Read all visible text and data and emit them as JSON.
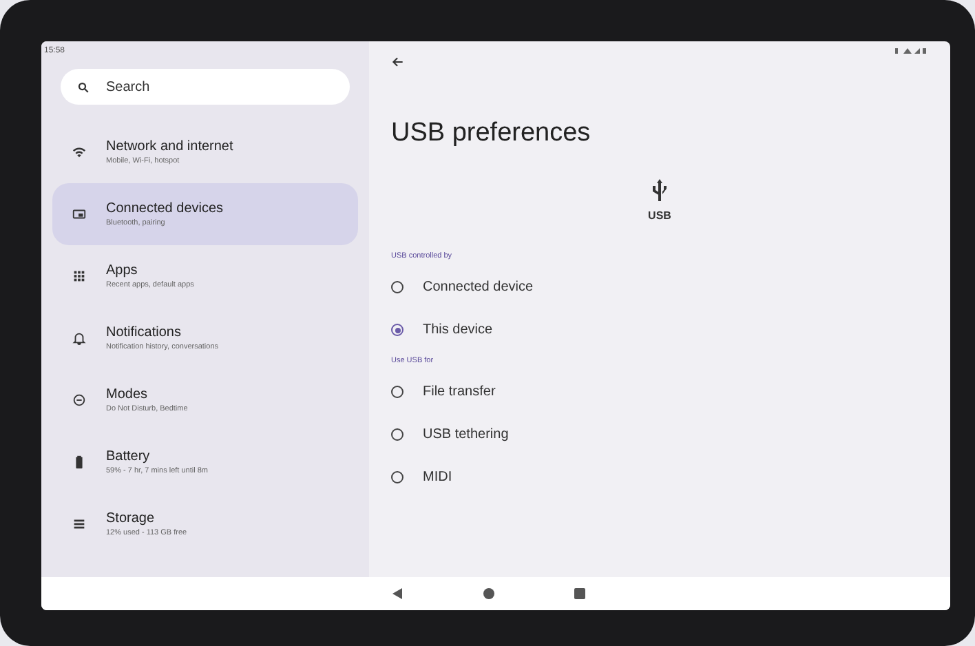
{
  "status_bar": {
    "time": "15:58"
  },
  "sidebar": {
    "search": {
      "placeholder": "Search"
    },
    "items": [
      {
        "kind": "wifi",
        "title": "Network and internet",
        "subtitle": "Mobile, Wi‑Fi, hotspot",
        "selected": false
      },
      {
        "kind": "devices",
        "title": "Connected devices",
        "subtitle": "Bluetooth, pairing",
        "selected": true
      },
      {
        "kind": "apps",
        "title": "Apps",
        "subtitle": "Recent apps, default apps",
        "selected": false
      },
      {
        "kind": "bell",
        "title": "Notifications",
        "subtitle": "Notification history, conversations",
        "selected": false
      },
      {
        "kind": "modes",
        "title": "Modes",
        "subtitle": "Do Not Disturb, Bedtime",
        "selected": false
      },
      {
        "kind": "battery",
        "title": "Battery",
        "subtitle": "59% - 7 hr, 7 mins left until 8m",
        "selected": false
      },
      {
        "kind": "storage",
        "title": "Storage",
        "subtitle": "12% used - 113 GB free",
        "selected": false
      }
    ]
  },
  "page": {
    "title": "USB preferences",
    "icon_label": "USB",
    "groups": [
      {
        "header": "USB controlled by",
        "options": [
          {
            "label": "Connected device",
            "selected": false
          },
          {
            "label": "This device",
            "selected": true
          }
        ]
      },
      {
        "header": "Use USB for",
        "options": [
          {
            "label": "File transfer",
            "selected": false
          },
          {
            "label": "USB tethering",
            "selected": false
          },
          {
            "label": "MIDI",
            "selected": false
          }
        ]
      }
    ]
  }
}
